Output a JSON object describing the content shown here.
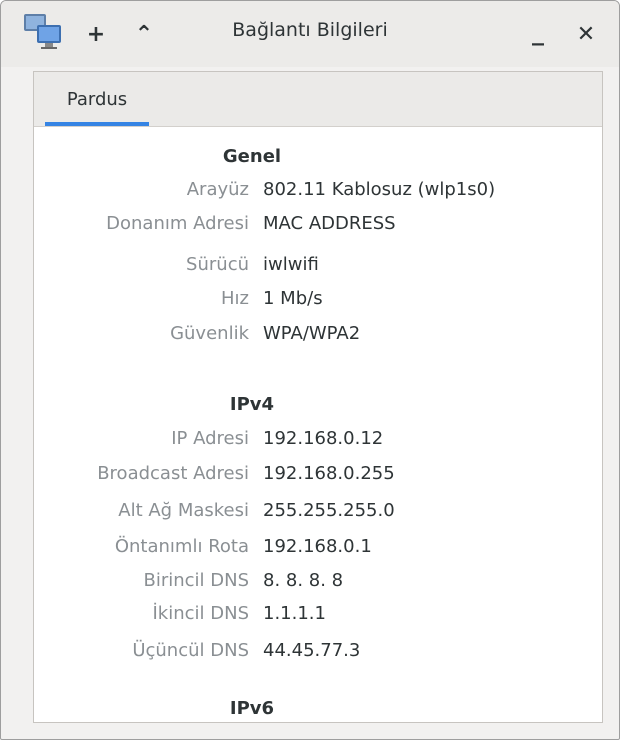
{
  "window": {
    "title": "Bağlantı Bilgileri",
    "add_label": "+",
    "up_label": "⌃",
    "minimize_label": "_",
    "close_label": "✕"
  },
  "tabs": [
    {
      "label": "Pardus",
      "active": true
    }
  ],
  "sections": {
    "genel": {
      "title": "Genel",
      "rows": [
        {
          "label": "Arayüz",
          "value": "802.11 Kablosuz (wlp1s0)"
        },
        {
          "label": "Donanım Adresi",
          "value": "MAC ADDRESS"
        },
        {
          "label": "Sürücü",
          "value": "iwlwifi"
        },
        {
          "label": "Hız",
          "value": "1 Mb/s"
        },
        {
          "label": "Güvenlik",
          "value": "WPA/WPA2"
        }
      ]
    },
    "ipv4": {
      "title": "IPv4",
      "rows": [
        {
          "label": "IP Adresi",
          "value": "192.168.0.12"
        },
        {
          "label": "Broadcast Adresi",
          "value": "192.168.0.255"
        },
        {
          "label": "Alt Ağ Maskesi",
          "value": "255.255.255.0"
        },
        {
          "label": "Öntanımlı Rota",
          "value": "192.168.0.1"
        },
        {
          "label": "Birincil DNS",
          "value": "8. 8. 8. 8"
        },
        {
          "label": "İkincil DNS",
          "value": "1.1.1.1"
        },
        {
          "label": "Üçüncül DNS",
          "value": "44.45.77.3"
        }
      ]
    },
    "ipv6": {
      "title": "IPv6"
    }
  },
  "colors": {
    "accent": "#3584e4",
    "label_text": "#8a8f93",
    "value_text": "#2e3436"
  }
}
